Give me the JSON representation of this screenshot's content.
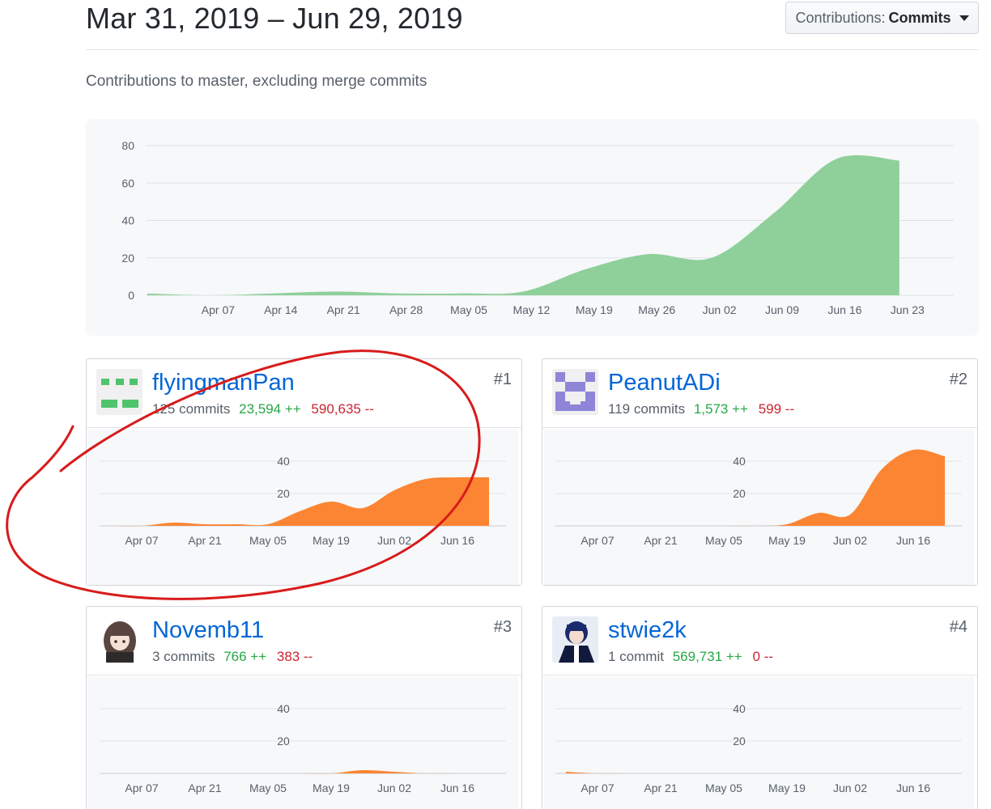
{
  "header": {
    "title": "Mar 31, 2019 – Jun 29, 2019",
    "dropdown_prefix": "Contributions:",
    "dropdown_value": "Commits"
  },
  "subtitle": "Contributions to master, excluding merge commits",
  "colors": {
    "main_area": "#8fd09a",
    "contributor_area": "#fb8532",
    "link": "#0366d6",
    "additions": "#28a745",
    "deletions": "#cb2431",
    "annotation": "#d81b1b"
  },
  "chart_data": [
    {
      "type": "area",
      "xlabel": "",
      "ylabel": "",
      "ylim": [
        0,
        80
      ],
      "y_ticks": [
        "0",
        "20",
        "40",
        "60",
        "80"
      ],
      "x_ticks": [
        "Apr 07",
        "Apr 14",
        "Apr 21",
        "Apr 28",
        "May 05",
        "May 12",
        "May 19",
        "May 26",
        "Jun 02",
        "Jun 09",
        "Jun 16",
        "Jun 23"
      ],
      "x": [
        "Mar 31",
        "Apr 07",
        "Apr 14",
        "Apr 21",
        "Apr 28",
        "May 05",
        "May 12",
        "May 19",
        "May 26",
        "Jun 02",
        "Jun 09",
        "Jun 16",
        "Jun 23"
      ],
      "values": [
        1,
        0,
        1,
        2,
        1,
        1,
        2,
        14,
        22,
        20,
        44,
        73,
        72
      ],
      "grid": true
    },
    {
      "type": "area",
      "ylim": [
        0,
        60
      ],
      "y_ticks": [
        "20",
        "40"
      ],
      "x_ticks": [
        "Apr 07",
        "Apr 21",
        "May 05",
        "May 19",
        "Jun 02",
        "Jun 16"
      ],
      "x": [
        "Mar 31",
        "Apr 07",
        "Apr 14",
        "Apr 21",
        "Apr 28",
        "May 05",
        "May 12",
        "May 19",
        "May 26",
        "Jun 02",
        "Jun 09",
        "Jun 16",
        "Jun 23"
      ],
      "values": [
        0,
        0,
        2,
        1,
        1,
        1,
        9,
        15,
        11,
        22,
        29,
        30,
        30
      ]
    },
    {
      "type": "area",
      "ylim": [
        0,
        60
      ],
      "y_ticks": [
        "20",
        "40"
      ],
      "x_ticks": [
        "Apr 07",
        "Apr 21",
        "May 05",
        "May 19",
        "Jun 02",
        "Jun 16"
      ],
      "x": [
        "Mar 31",
        "Apr 07",
        "Apr 14",
        "Apr 21",
        "Apr 28",
        "May 05",
        "May 12",
        "May 19",
        "May 26",
        "Jun 02",
        "Jun 09",
        "Jun 16",
        "Jun 23"
      ],
      "values": [
        0,
        0,
        0,
        0,
        0,
        0,
        0,
        1,
        8,
        7,
        35,
        47,
        43
      ]
    },
    {
      "type": "area",
      "ylim": [
        0,
        60
      ],
      "y_ticks": [
        "20",
        "40"
      ],
      "x_ticks": [
        "Apr 07",
        "Apr 21",
        "May 05",
        "May 19",
        "Jun 02",
        "Jun 16"
      ],
      "x": [
        "Mar 31",
        "Apr 07",
        "Apr 14",
        "Apr 21",
        "Apr 28",
        "May 05",
        "May 12",
        "May 19",
        "May 26",
        "Jun 02",
        "Jun 09",
        "Jun 16",
        "Jun 23"
      ],
      "values": [
        0,
        0,
        0,
        0,
        0,
        0,
        0,
        0,
        2,
        1,
        0,
        0,
        0
      ]
    },
    {
      "type": "area",
      "ylim": [
        0,
        60
      ],
      "y_ticks": [
        "20",
        "40"
      ],
      "x_ticks": [
        "Apr 07",
        "Apr 21",
        "May 05",
        "May 19",
        "Jun 02",
        "Jun 16"
      ],
      "x": [
        "Mar 31",
        "Apr 07",
        "Apr 14",
        "Apr 21",
        "Apr 28",
        "May 05",
        "May 12",
        "May 19",
        "May 26",
        "Jun 02",
        "Jun 09",
        "Jun 16",
        "Jun 23"
      ],
      "values": [
        1,
        0,
        0,
        0,
        0,
        0,
        0,
        0,
        0,
        0,
        0,
        0,
        0
      ]
    }
  ],
  "contributors": [
    {
      "name": "flyingmanPan",
      "commits": "125 commits",
      "additions": "23,594 ++",
      "deletions": "590,635 --",
      "rank": "#1",
      "avatar": "identicon-green"
    },
    {
      "name": "PeanutADi",
      "commits": "119 commits",
      "additions": "1,573 ++",
      "deletions": "599 --",
      "rank": "#2",
      "avatar": "identicon-purple"
    },
    {
      "name": "Novemb11",
      "commits": "3 commits",
      "additions": "766 ++",
      "deletions": "383 --",
      "rank": "#3",
      "avatar": "anime-girl-avatar"
    },
    {
      "name": "stwie2k",
      "commits": "1 commit",
      "additions": "569,731 ++",
      "deletions": "0 --",
      "rank": "#4",
      "avatar": "anime-boy-avatar"
    }
  ]
}
